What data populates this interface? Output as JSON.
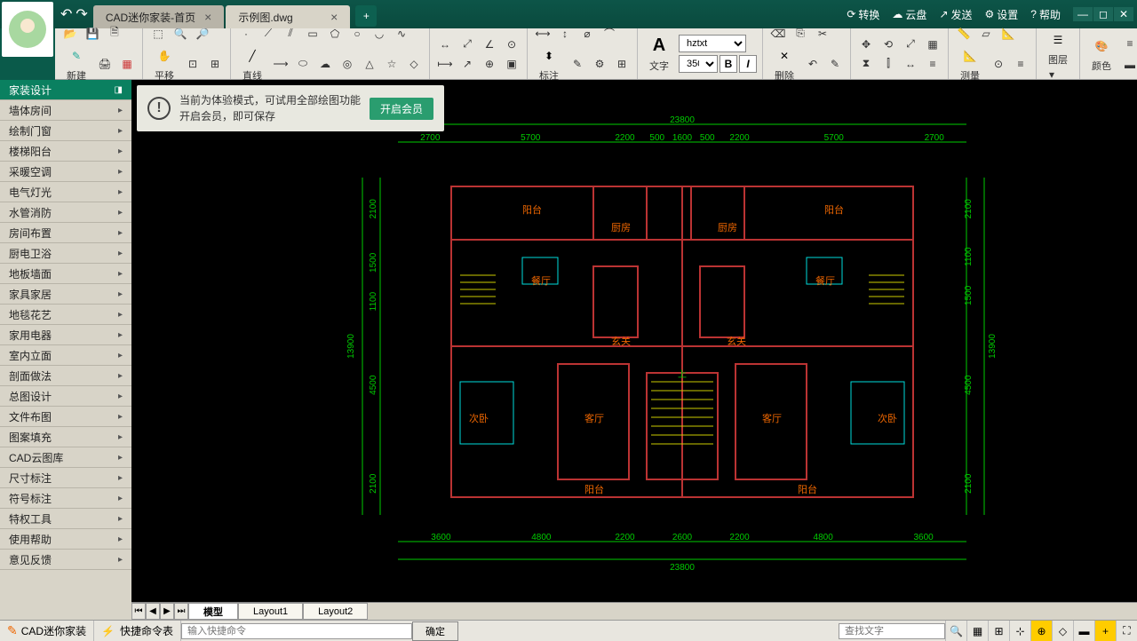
{
  "titlebar": {
    "tabs": [
      {
        "label": "CAD迷你家装-首页",
        "active": false
      },
      {
        "label": "示例图.dwg",
        "active": true
      }
    ],
    "links": [
      "转换",
      "云盘",
      "发送",
      "设置",
      "帮助"
    ]
  },
  "toolbar": {
    "new_label": "新建",
    "pan_label": "平移",
    "line_label": "直线",
    "annotate_label": "标注",
    "text_label": "文字",
    "font_name": "hztxt",
    "font_size": "350",
    "delete_label": "删除",
    "measure_label": "测量",
    "layer_label": "图层",
    "color_label": "颜色"
  },
  "sidebar": {
    "items": [
      "家装设计",
      "墙体房间",
      "绘制门窗",
      "楼梯阳台",
      "采暖空调",
      "电气灯光",
      "水管消防",
      "房间布置",
      "厨电卫浴",
      "地板墙面",
      "家具家居",
      "地毯花艺",
      "家用电器",
      "室内立面",
      "剖面做法",
      "总图设计",
      "文件布图",
      "图案填充",
      "CAD云图库",
      "尺寸标注",
      "符号标注",
      "特权工具",
      "使用帮助",
      "意见反馈"
    ],
    "active_index": 0
  },
  "banner": {
    "line1": "当前为体验模式，可试用全部绘图功能",
    "line2": "开启会员，即可保存",
    "button": "开启会员"
  },
  "drawing": {
    "total_width": "23800",
    "top_dims": [
      "2700",
      "5700",
      "2200",
      "500",
      "1600",
      "500",
      "2200",
      "5700",
      "2700"
    ],
    "bottom_dims": [
      "3600",
      "4800",
      "2200",
      "2600",
      "2200",
      "4800",
      "3600"
    ],
    "left_dims_outer": "13900",
    "left_dims": [
      "2100",
      "1500",
      "1100",
      "4500",
      "2100"
    ],
    "right_dims": [
      "2100",
      "1100",
      "1500",
      "4500",
      "2100"
    ],
    "rooms": [
      "阳台",
      "厨房",
      "厨房",
      "阳台",
      "餐厅",
      "餐厅",
      "玄关",
      "玄关",
      "次卧",
      "客厅",
      "客厅",
      "次卧",
      "阳台",
      "阳台"
    ],
    "stairs_label": "上"
  },
  "layout_tabs": [
    "模型",
    "Layout1",
    "Layout2"
  ],
  "statusbar": {
    "app_name": "CAD迷你家装",
    "shortcut_label": "快捷命令表",
    "cmd_placeholder": "输入快捷命令",
    "confirm": "确定",
    "search_placeholder": "查找文字"
  },
  "colors": {
    "swatches": [
      "#ffffff",
      "#ff0000",
      "#ffff00",
      "#00ff00",
      "#000000",
      "#0000ff",
      "#ff8800",
      "#00ffff"
    ]
  }
}
